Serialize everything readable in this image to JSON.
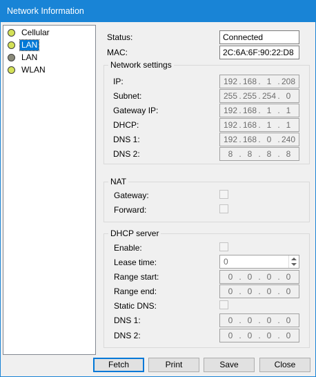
{
  "window": {
    "title": "Network Information"
  },
  "tree": {
    "items": [
      {
        "label": "Cellular",
        "color": "#d4e157",
        "selected": false
      },
      {
        "label": "LAN",
        "color": "#d4e157",
        "selected": true
      },
      {
        "label": "LAN",
        "color": "#8a8a7a",
        "selected": false
      },
      {
        "label": "WLAN",
        "color": "#d4e157",
        "selected": false
      }
    ]
  },
  "status": {
    "label": "Status:",
    "value": "Connected"
  },
  "mac": {
    "label": "MAC:",
    "value": "2C:6A:6F:90:22:D8"
  },
  "network_settings": {
    "title": "Network settings",
    "fields": [
      {
        "label": "IP:",
        "octets": [
          "192",
          "168",
          "1",
          "208"
        ]
      },
      {
        "label": "Subnet:",
        "octets": [
          "255",
          "255",
          "254",
          "0"
        ]
      },
      {
        "label": "Gateway IP:",
        "octets": [
          "192",
          "168",
          "1",
          "1"
        ]
      },
      {
        "label": "DHCP:",
        "octets": [
          "192",
          "168",
          "1",
          "1"
        ]
      },
      {
        "label": "DNS 1:",
        "octets": [
          "192",
          "168",
          "0",
          "240"
        ]
      },
      {
        "label": "DNS 2:",
        "octets": [
          "8",
          "8",
          "8",
          "8"
        ]
      }
    ]
  },
  "nat": {
    "title": "NAT",
    "gateway_label": "Gateway:",
    "forward_label": "Forward:"
  },
  "dhcp_server": {
    "title": "DHCP server",
    "enable_label": "Enable:",
    "lease_label": "Lease time:",
    "lease_value": "0",
    "range_start_label": "Range start:",
    "range_start": [
      "0",
      "0",
      "0",
      "0"
    ],
    "range_end_label": "Range end:",
    "range_end": [
      "0",
      "0",
      "0",
      "0"
    ],
    "static_dns_label": "Static DNS:",
    "dns1_label": "DNS 1:",
    "dns1": [
      "0",
      "0",
      "0",
      "0"
    ],
    "dns2_label": "DNS 2:",
    "dns2": [
      "0",
      "0",
      "0",
      "0"
    ]
  },
  "buttons": {
    "fetch": "Fetch",
    "print": "Print",
    "save": "Save",
    "close": "Close"
  }
}
